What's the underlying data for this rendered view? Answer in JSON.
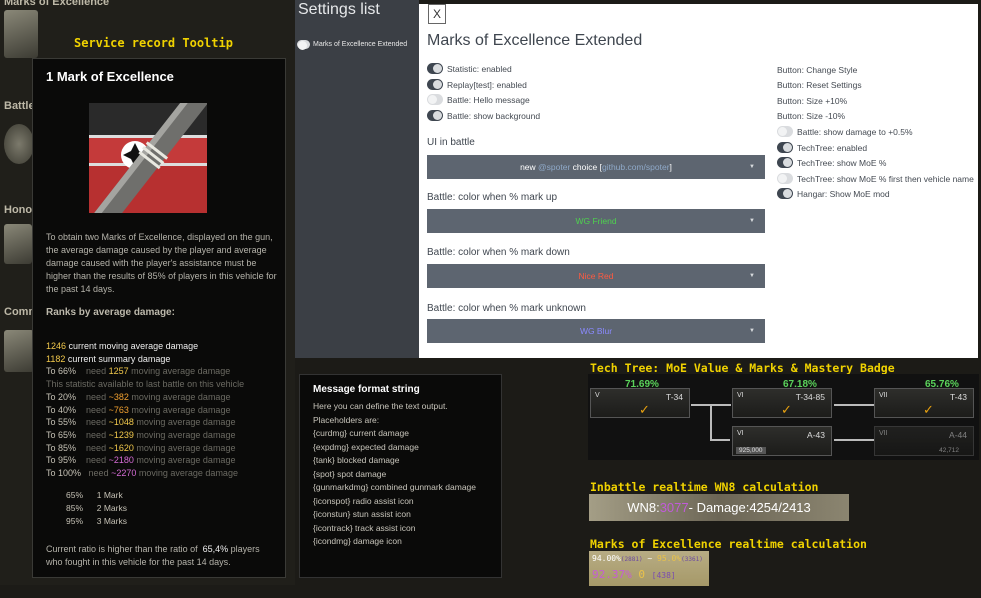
{
  "left": {
    "heading_top": "Marks of Excellence",
    "heading_battle": "Battle",
    "heading_honor": "Honor",
    "heading_comm": "Comm",
    "service_record_title": "Service record Tooltip"
  },
  "tooltip": {
    "title": "1 Mark of Excellence",
    "description": "To obtain two Marks of Excellence, displayed on the gun, the average damage caused by the player and average damage caused with the player's assistance must be higher than the results of 85% of players in this vehicle for the past 14 days.",
    "ranks_title": "Ranks by average damage:",
    "current_moving_value": "1246",
    "current_moving_label": "current moving average damage",
    "current_summary_value": "1182",
    "current_summary_label": "current summary damage",
    "rows": [
      {
        "to": "To 66%",
        "need": "need",
        "value": "1257",
        "label": "moving average damage"
      },
      {
        "to": "To 20%",
        "need": "need",
        "value": "~382",
        "label": "moving average damage"
      },
      {
        "to": "To 40%",
        "need": "need",
        "value": "~763",
        "label": "moving average damage"
      },
      {
        "to": "To 55%",
        "need": "need",
        "value": "~1048",
        "label": "moving average damage"
      },
      {
        "to": "To 65%",
        "need": "need",
        "value": "~1239",
        "label": "moving average damage"
      },
      {
        "to": "To 85%",
        "need": "need",
        "value": "~1620",
        "label": "moving average damage"
      },
      {
        "to": "To 95%",
        "need": "need",
        "value": "~2180",
        "label": "moving average damage"
      },
      {
        "to": "To 100%",
        "need": "need",
        "value": "~2270",
        "label": "moving average damage"
      }
    ],
    "last_battle_note": "This statistic available to last battle on this vehicle",
    "marks": [
      {
        "pct": "65%",
        "label": "1 Mark"
      },
      {
        "pct": "85%",
        "label": "2 Marks"
      },
      {
        "pct": "95%",
        "label": "3 Marks"
      }
    ],
    "footer_prefix": "Current ratio is higher than the ratio of",
    "footer_value": "65,4%",
    "footer_suffix": "players who fought in this vehicle for the past 14 days."
  },
  "settings": {
    "list_title": "Settings list",
    "list_item": "Marks of Excellence Extended",
    "close_label": "X",
    "mod_title": "Marks of Excellence Extended",
    "left_toggles": [
      {
        "label": "Statistic: enabled",
        "on": true
      },
      {
        "label": "Replay[test]: enabled",
        "on": true
      },
      {
        "label": "Battle: Hello message",
        "on": false
      },
      {
        "label": "Battle: show background",
        "on": true
      }
    ],
    "right_buttons": [
      "Button: Change Style",
      "Button: Reset Settings",
      "Button: Size +10%",
      "Button: Size -10%"
    ],
    "right_toggles": [
      {
        "label": "Battle: show damage to +0.5%",
        "on": false
      },
      {
        "label": "TechTree: enabled",
        "on": true
      },
      {
        "label": "TechTree: show MoE %",
        "on": true
      },
      {
        "label": "TechTree: show MoE % first then vehicle name",
        "on": false
      },
      {
        "label": "Hangar: Show MoE mod",
        "on": true
      }
    ],
    "ui_label": "UI in battle",
    "ui_value_prefix": "new ",
    "ui_value_name": "@spoter",
    "ui_value_mid": " choice [",
    "ui_value_link": "github.com/spoter",
    "ui_value_suffix": "]",
    "markup_label": "Battle: color when % mark up",
    "markup_value": "WG Friend",
    "markdown_label": "Battle: color when % mark down",
    "markdown_value": "Nice Red",
    "unknown_label": "Battle: color when % mark unknown",
    "unknown_value": "WG Blur",
    "colors": {
      "friend": "#4ed24e",
      "red": "#ff5a40",
      "blur": "#8a8aff",
      "link": "#8fa9c8"
    }
  },
  "message": {
    "title": "Message format string",
    "lines": [
      "Here you can define the text output.",
      "Placeholders are:",
      "{curdmg} current damage",
      "{expdmg} expected damage",
      "{tank} blocked damage",
      "{spot} spot damage",
      "{gunmarkdmg} combined gunmark damage",
      "{iconspot} radio assist icon",
      "{iconstun} stun assist icon",
      "{icontrack} track assist icon",
      "{icondmg} damage icon"
    ]
  },
  "techtree": {
    "title": "Tech Tree: MoE Value & Marks & Mastery Badge",
    "tanks": [
      {
        "name": "T-34",
        "moe": "71.69%",
        "lvl": "V"
      },
      {
        "name": "T-34-85",
        "moe": "67.18%",
        "lvl": "VI"
      },
      {
        "name": "T-43",
        "moe": "65.76%",
        "lvl": "VII"
      },
      {
        "name": "A-43",
        "lvl": "VI",
        "price": "925,000"
      },
      {
        "name": "A-44",
        "lvl": "VII",
        "xp": "42,712"
      }
    ]
  },
  "wn8": {
    "title": "Inbattle realtime WN8 calculation",
    "label": "WN8: ",
    "value": "3077",
    "rest": " - Damage:4254/2413"
  },
  "moe_rt": {
    "title": "Marks of Excellence realtime calculation",
    "r1a": "94.00%",
    "r1a_small": "(2881)",
    "r1mid": " ~ ",
    "r1b": "95.0%",
    "r1b_small": "(3361)",
    "r2": "92.37% ",
    "r2b": "0",
    "r2c": "438"
  }
}
